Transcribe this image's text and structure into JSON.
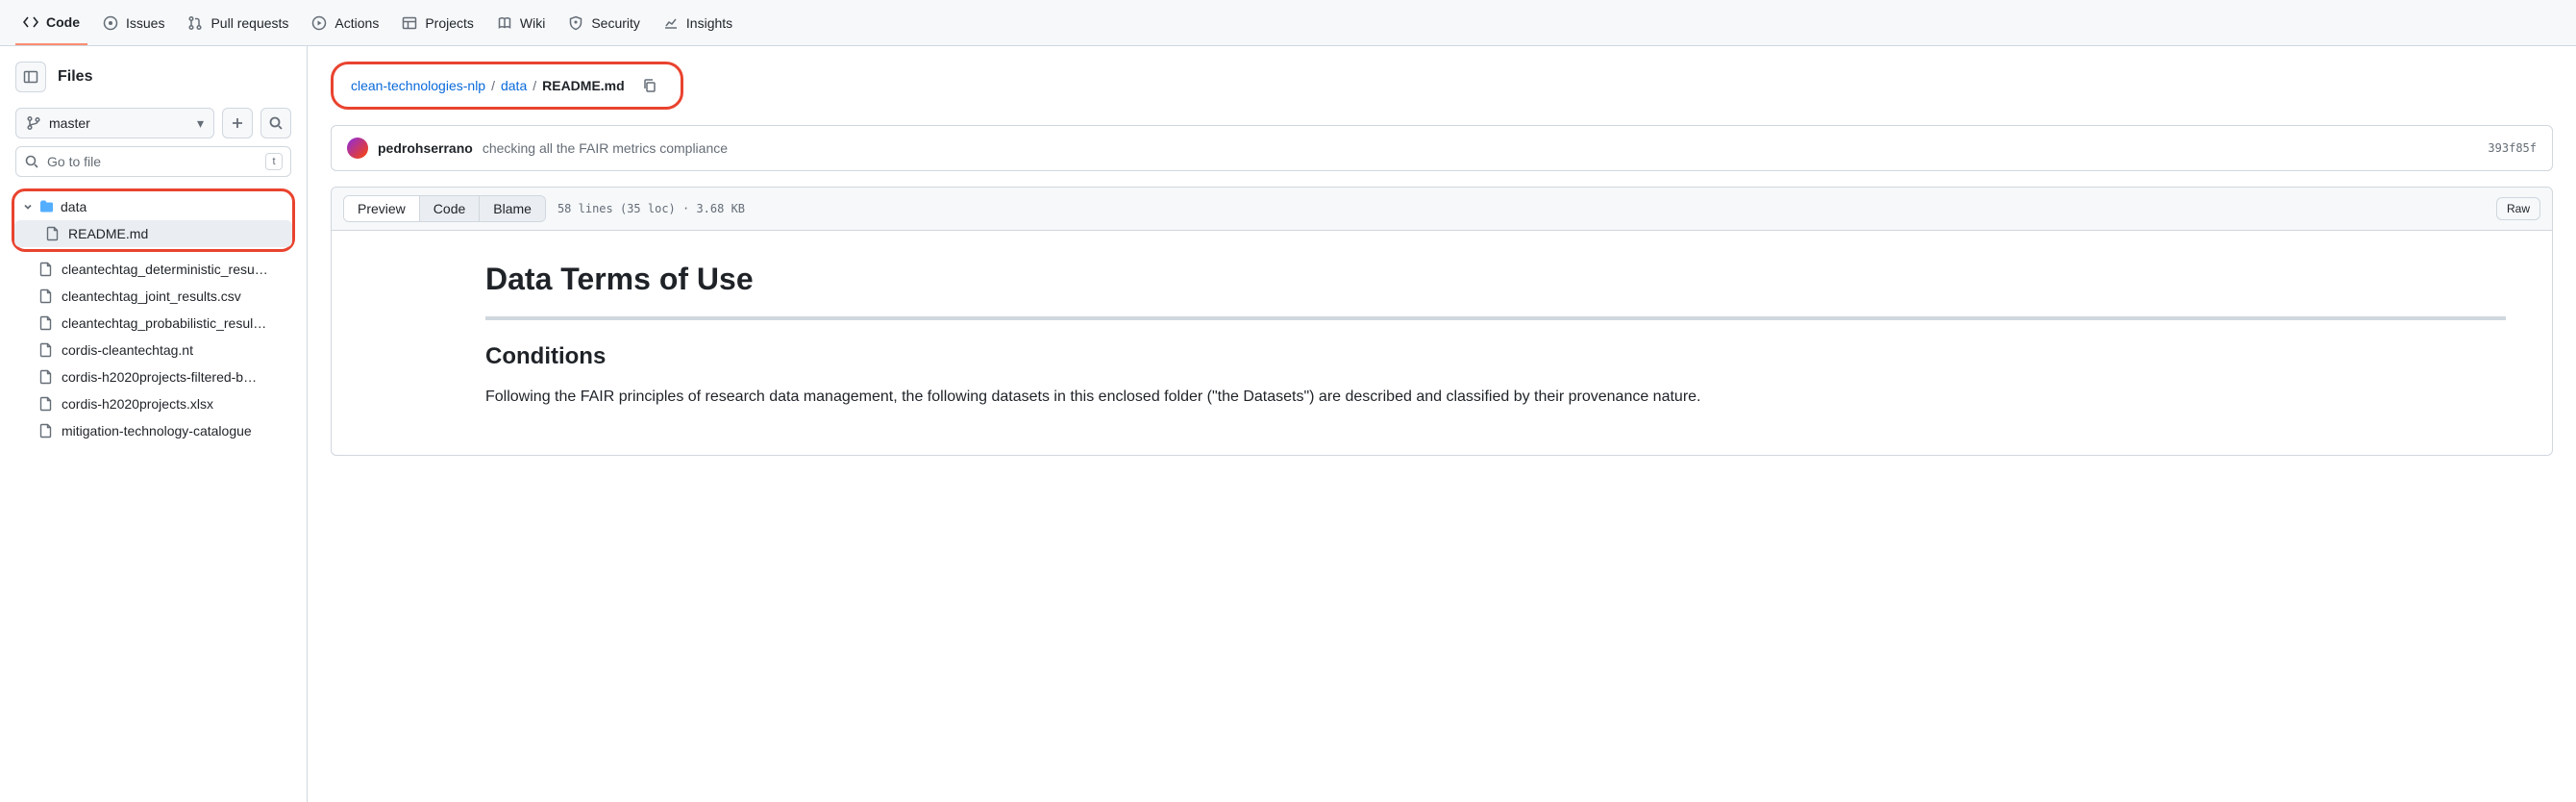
{
  "nav": {
    "tabs": [
      {
        "label": "Code",
        "icon": "code"
      },
      {
        "label": "Issues",
        "icon": "issue"
      },
      {
        "label": "Pull requests",
        "icon": "pr"
      },
      {
        "label": "Actions",
        "icon": "play"
      },
      {
        "label": "Projects",
        "icon": "table"
      },
      {
        "label": "Wiki",
        "icon": "book"
      },
      {
        "label": "Security",
        "icon": "shield"
      },
      {
        "label": "Insights",
        "icon": "graph"
      }
    ]
  },
  "sidebar": {
    "title": "Files",
    "branch": "master",
    "search_placeholder": "Go to file",
    "search_kbd": "t",
    "folder": "data",
    "files": [
      "README.md",
      "cleantechtag_deterministic_resu…",
      "cleantechtag_joint_results.csv",
      "cleantechtag_probabilistic_resul…",
      "cordis-cleantechtag.nt",
      "cordis-h2020projects-filtered-b…",
      "cordis-h2020projects.xlsx",
      "mitigation-technology-catalogue"
    ]
  },
  "breadcrumb": {
    "repo": "clean-technologies-nlp",
    "folder": "data",
    "file": "README.md"
  },
  "commit": {
    "author": "pedrohserrano",
    "message": "checking all the FAIR metrics compliance",
    "sha": "393f85f"
  },
  "file_header": {
    "preview": "Preview",
    "code": "Code",
    "blame": "Blame",
    "meta": "58 lines (35 loc) · 3.68 KB",
    "raw": "Raw"
  },
  "readme": {
    "h1": "Data Terms of Use",
    "h2": "Conditions",
    "p1": "Following the FAIR principles of research data management, the following datasets in this enclosed folder (\"the Datasets\") are described and classified by their provenance nature."
  }
}
